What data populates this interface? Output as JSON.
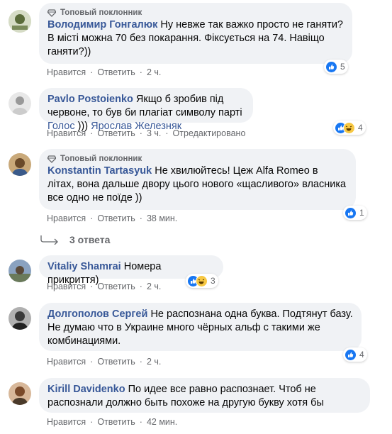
{
  "badge_label": "Топовый поклонник",
  "actions": {
    "like": "Нравится",
    "reply": "Ответить",
    "sep": "·"
  },
  "comments": [
    {
      "author": "Володимир Гонгалюк",
      "text": "Ну невже так важко просто не ганяти? В місті можна 70 без покарання. Фіксується на 74. Навіщо ганяти?))",
      "time": "2 ч.",
      "reactions": [
        "like"
      ],
      "count": "5",
      "avatar_color": "#b8c8a8"
    },
    {
      "author": "Pavlo Postoienko",
      "text_before": "Якщо б зробив під червоне, то був би плагіат символу парті ",
      "link1": "Голос",
      "text_mid": " ))) ",
      "link2": "Ярослав Железняк",
      "time": "3 ч.",
      "edited": "Отредактировано",
      "reactions": [
        "like",
        "haha"
      ],
      "count": "4",
      "avatar_color": "#d9d9d9"
    },
    {
      "author": "Konstantin Tartasyuk",
      "text": "Не хвилюйтесь! Цеж Alfa Romeo в літах, вона дальше двору цього нового «щасливого» власника все одно не поїде ))",
      "time": "38 мин.",
      "reactions": [
        "like"
      ],
      "count": "1",
      "avatar_color": "#8a6a4a"
    },
    {
      "author": "Vitaliy Shamrai",
      "text": "Номера прикриття)",
      "time": "2 ч.",
      "reactions": [
        "like",
        "haha"
      ],
      "count": "3",
      "avatar_color": "#7a8a9a"
    },
    {
      "author": "Долгополов Сергей",
      "text": "Не распознана одна буква. Подтянут базу. Не думаю что в Украине много чёрных альф с такими же комбинациями.",
      "time": "2 ч.",
      "reactions": [
        "like"
      ],
      "count": "4",
      "avatar_color": "#6a6a6a"
    },
    {
      "author": "Kirill Davidenko",
      "text": "По идее все равно распознает. Чтоб не распознали должно быть похоже на другую букву хотя бы",
      "time": "42 мин.",
      "avatar_color": "#9a6a4a"
    }
  ],
  "replies_label": "3 ответа",
  "colors": {
    "link": "#385898",
    "bubble": "#f0f2f5",
    "meta": "#65676b",
    "like": "#1877f2",
    "haha": "#f7c843"
  }
}
